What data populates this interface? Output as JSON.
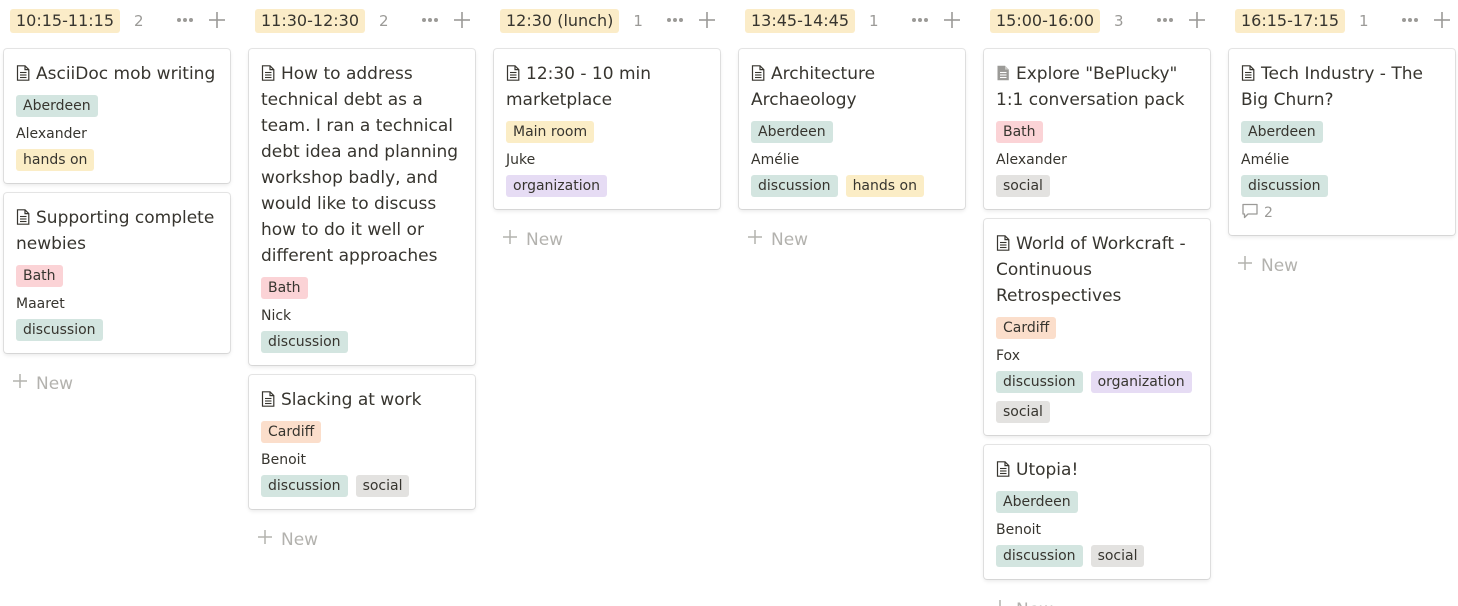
{
  "colors": {
    "column_header_bg": "#fbecc8",
    "tag_teal": "#d3e5e0",
    "tag_yellow": "#fbedc6",
    "tag_pink": "#fbd3d6",
    "tag_orange": "#fbdecb",
    "tag_purple": "#e6dcf4",
    "tag_gray": "#e3e2e0"
  },
  "new_label": "New",
  "columns": [
    {
      "title": "10:15-11:15",
      "count": "2",
      "cards": [
        {
          "title": "AsciiDoc mob writing",
          "room": {
            "label": "Aberdeen",
            "color": "teal"
          },
          "person": "Alexander",
          "tags": [
            {
              "label": "hands on",
              "color": "yellow"
            }
          ]
        },
        {
          "title": "Supporting complete newbies",
          "room": {
            "label": "Bath",
            "color": "pink"
          },
          "person": "Maaret",
          "tags": [
            {
              "label": "discussion",
              "color": "teal"
            }
          ]
        }
      ]
    },
    {
      "title": "11:30-12:30",
      "count": "2",
      "cards": [
        {
          "title": "How to address technical debt as a team. I ran a technical debt idea and planning workshop badly, and would like to discuss how to do it well or different approaches",
          "room": {
            "label": "Bath",
            "color": "pink"
          },
          "person": "Nick",
          "tags": [
            {
              "label": "discussion",
              "color": "teal"
            }
          ]
        },
        {
          "title": "Slacking at work",
          "room": {
            "label": "Cardiff",
            "color": "orange"
          },
          "person": "Benoit",
          "tags": [
            {
              "label": "discussion",
              "color": "teal"
            },
            {
              "label": "social",
              "color": "gray"
            }
          ]
        }
      ]
    },
    {
      "title": "12:30 (lunch)",
      "count": "1",
      "cards": [
        {
          "title": "12:30 - 10 min marketplace",
          "room": {
            "label": "Main room",
            "color": "yellow"
          },
          "person": "Juke",
          "tags": [
            {
              "label": "organization",
              "color": "purple"
            }
          ]
        }
      ]
    },
    {
      "title": "13:45-14:45",
      "count": "1",
      "cards": [
        {
          "title": "Architecture Archaeology",
          "room": {
            "label": "Aberdeen",
            "color": "teal"
          },
          "person": "Amélie",
          "tags": [
            {
              "label": "discussion",
              "color": "teal"
            },
            {
              "label": "hands on",
              "color": "yellow"
            }
          ]
        }
      ]
    },
    {
      "title": "15:00-16:00",
      "count": "3",
      "cards": [
        {
          "title": "Explore \"BePlucky\" 1:1 conversation pack",
          "icon": "document-filled-icon",
          "room": {
            "label": "Bath",
            "color": "pink"
          },
          "person": "Alexander",
          "tags": [
            {
              "label": "social",
              "color": "gray"
            }
          ]
        },
        {
          "title": "World of Workcraft - Continuous Retrospectives",
          "room": {
            "label": "Cardiff",
            "color": "orange"
          },
          "person": "Fox",
          "tags": [
            {
              "label": "discussion",
              "color": "teal"
            },
            {
              "label": "organization",
              "color": "purple"
            },
            {
              "label": "social",
              "color": "gray"
            }
          ]
        },
        {
          "title": "Utopia!",
          "room": {
            "label": "Aberdeen",
            "color": "teal"
          },
          "person": "Benoit",
          "tags": [
            {
              "label": "discussion",
              "color": "teal"
            },
            {
              "label": "social",
              "color": "gray"
            }
          ]
        }
      ]
    },
    {
      "title": "16:15-17:15",
      "count": "1",
      "cards": [
        {
          "title": "Tech Industry - The Big Churn?",
          "room": {
            "label": "Aberdeen",
            "color": "teal"
          },
          "person": "Amélie",
          "tags": [
            {
              "label": "discussion",
              "color": "teal"
            }
          ],
          "comments": "2"
        }
      ]
    }
  ]
}
